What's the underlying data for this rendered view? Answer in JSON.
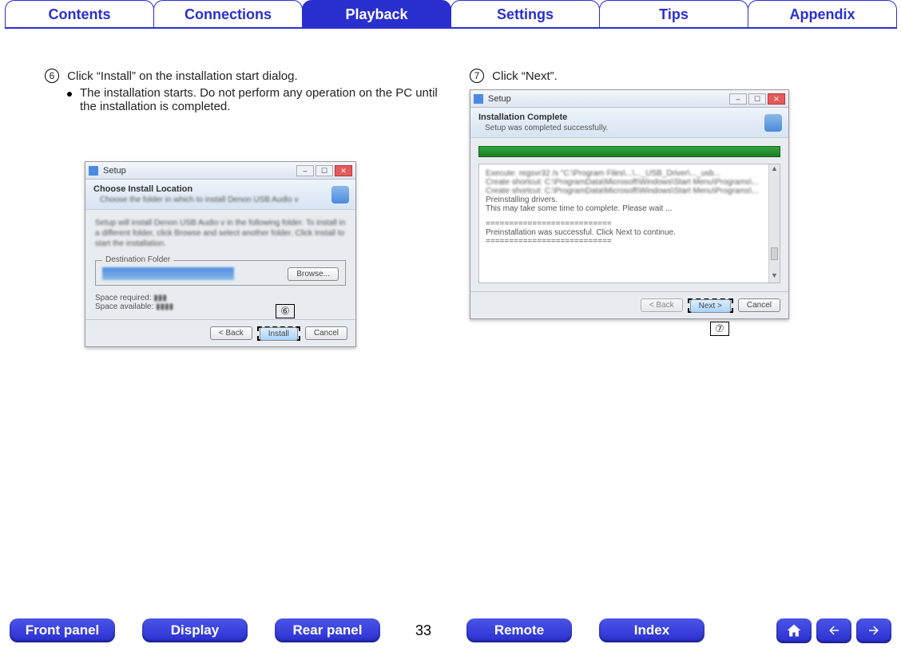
{
  "tabs": {
    "contents": "Contents",
    "connections": "Connections",
    "playback": "Playback",
    "settings": "Settings",
    "tips": "Tips",
    "appendix": "Appendix"
  },
  "left": {
    "stepNum": "6",
    "stepText": "Click “Install” on the installation start dialog.",
    "bullet": "The installation starts. Do not perform any operation on the PC until the installation is completed.",
    "win": {
      "title": "Setup",
      "headerTitle": "Choose Install Location",
      "headerSub": "Choose the folder in which to install Denon USB Audio v",
      "bodyText": "Setup will install Denon USB Audio v        in the following folder. To install in a different folder, click Browse and select another folder. Click Install to start the installation.",
      "destLabel": "Destination Folder",
      "browse": "Browse...",
      "spaceReq": "Space required:",
      "spaceAvail": "Space available:",
      "back": "< Back",
      "install": "Install",
      "cancel": "Cancel"
    },
    "callout": "⑥"
  },
  "right": {
    "stepNum": "7",
    "stepText": "Click “Next”.",
    "win": {
      "title": "Setup",
      "headerTitle": "Installation Complete",
      "headerSub": "Setup was completed successfully.",
      "log1": "Preinstalling drivers.",
      "log2": "This may take some time to complete. Please wait ...",
      "sep": "===========================",
      "log3": "Preinstallation was successful. Click Next to continue.",
      "back": "< Back",
      "next": "Next >",
      "cancel": "Cancel"
    },
    "callout": "⑦"
  },
  "bottom": {
    "front": "Front panel",
    "display": "Display",
    "rear": "Rear panel",
    "pageNum": "33",
    "remote": "Remote",
    "index": "Index"
  }
}
